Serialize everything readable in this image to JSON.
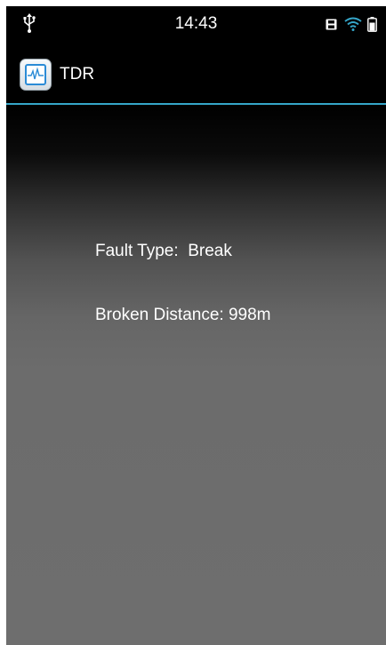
{
  "status_bar": {
    "time": "14:43",
    "icons": [
      "usb-icon",
      "sd-card-icon",
      "wifi-icon",
      "battery-icon"
    ],
    "wifi_color": "#35a6c9",
    "battery_level": 0.7
  },
  "app_bar": {
    "title": "TDR",
    "icon": "waveform-icon",
    "divider_color": "#35a6c9"
  },
  "result": {
    "fault_type_label": "Fault Type:",
    "fault_type_value": "Break",
    "distance_label": "Broken Distance:",
    "distance_value": "998m"
  }
}
